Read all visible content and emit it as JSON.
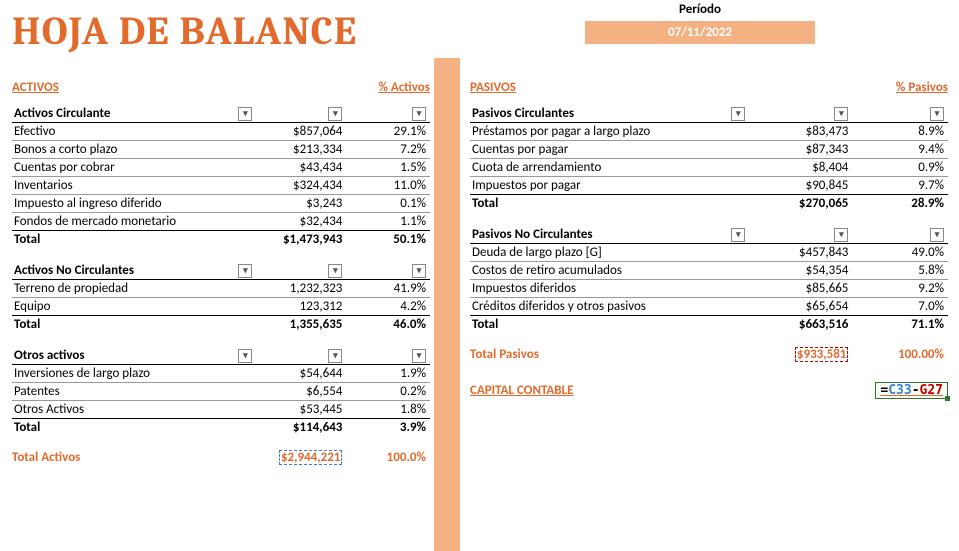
{
  "title": "HOJA DE BALANCE",
  "period": {
    "label": "Período",
    "date": "07/11/2022"
  },
  "left": {
    "header": "ACTIVOS",
    "pct_header": "% Activos",
    "sections": [
      {
        "title": "Activos Circulante",
        "rows": [
          {
            "name": "Efectivo",
            "val": "$857,064",
            "pct": "29.1%"
          },
          {
            "name": "Bonos a corto plazo",
            "val": "$213,334",
            "pct": "7.2%"
          },
          {
            "name": "Cuentas por cobrar",
            "val": "$43,434",
            "pct": "1.5%"
          },
          {
            "name": "Inventarios",
            "val": "$324,434",
            "pct": "11.0%"
          },
          {
            "name": "Impuesto al ingreso diferido",
            "val": "$3,243",
            "pct": "0.1%"
          },
          {
            "name": "Fondos de mercado monetario",
            "val": "$32,434",
            "pct": "1.1%"
          }
        ],
        "total": {
          "name": "Total",
          "val": "$1,473,943",
          "pct": "50.1%"
        }
      },
      {
        "title": "Activos No Circulantes",
        "rows": [
          {
            "name": "Terreno de propiedad",
            "val": "1,232,323",
            "pct": "41.9%"
          },
          {
            "name": "Equipo",
            "val": "123,312",
            "pct": "4.2%"
          }
        ],
        "total": {
          "name": "Total",
          "val": "1,355,635",
          "pct": "46.0%"
        }
      },
      {
        "title": "Otros activos",
        "rows": [
          {
            "name": "Inversiones de largo plazo",
            "val": "$54,644",
            "pct": "1.9%"
          },
          {
            "name": "Patentes",
            "val": "$6,554",
            "pct": "0.2%"
          },
          {
            "name": "Otros Activos",
            "val": "$53,445",
            "pct": "1.8%"
          }
        ],
        "total": {
          "name": "Total",
          "val": "$114,643",
          "pct": "3.9%"
        }
      }
    ],
    "grand": {
      "label": "Total Activos",
      "val": "$2,944,221",
      "pct": "100.0%"
    }
  },
  "right": {
    "header": "PASIVOS",
    "pct_header": "% Pasivos",
    "sections": [
      {
        "title": "Pasivos Circulantes",
        "rows": [
          {
            "name": "Préstamos por pagar a largo plazo",
            "val": "$83,473",
            "pct": "8.9%"
          },
          {
            "name": "Cuentas por pagar",
            "val": "$87,343",
            "pct": "9.4%"
          },
          {
            "name": "Cuota de arrendamiento",
            "val": "$8,404",
            "pct": "0.9%"
          },
          {
            "name": "Impuestos por pagar",
            "val": "$90,845",
            "pct": "9.7%"
          }
        ],
        "total": {
          "name": "Total",
          "val": "$270,065",
          "pct": "28.9%"
        }
      },
      {
        "title": "Pasivos No Circulantes",
        "rows": [
          {
            "name": "Deuda de largo plazo [G]",
            "val": "$457,843",
            "pct": "49.0%"
          },
          {
            "name": "Costos de retiro acumulados",
            "val": "$54,354",
            "pct": "5.8%"
          },
          {
            "name": "Impuestos diferidos",
            "val": "$85,665",
            "pct": "9.2%"
          },
          {
            "name": "Créditos diferidos y otros pasivos",
            "val": "$65,654",
            "pct": "7.0%"
          }
        ],
        "total": {
          "name": "Total",
          "val": "$663,516",
          "pct": "71.1%"
        }
      }
    ],
    "grand": {
      "label": "Total Pasivos",
      "val": "$933,581",
      "pct": "100.00%"
    },
    "capital": {
      "label": "CAPITAL CONTABLE",
      "formula_a": "C33",
      "formula_b": "G27"
    }
  }
}
